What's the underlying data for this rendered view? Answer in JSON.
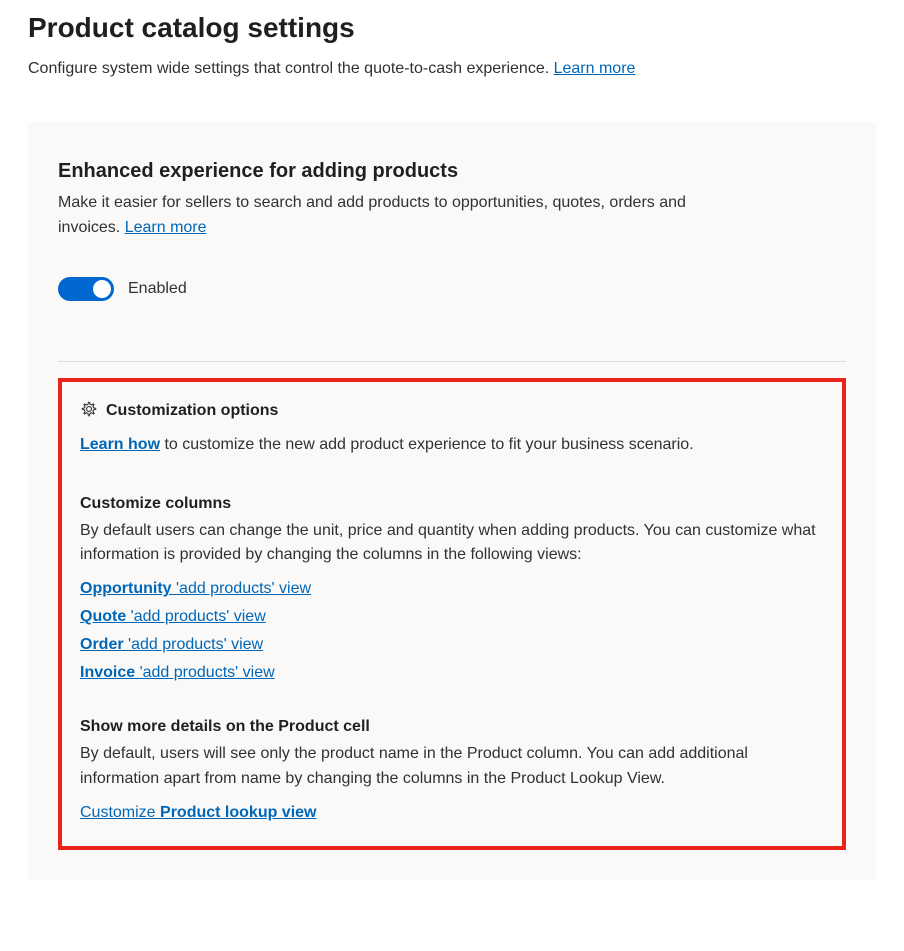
{
  "header": {
    "title": "Product catalog settings",
    "subtitle_prefix": "Configure system wide settings that control the quote-to-cash experience. ",
    "learn_more": "Learn more"
  },
  "enhanced": {
    "title": "Enhanced experience for adding products",
    "desc_prefix": "Make it easier for sellers to search and add products to opportunities, quotes, orders and invoices. ",
    "learn_more": "Learn more",
    "toggle_label": "Enabled"
  },
  "customization": {
    "header": "Customization options",
    "desc_link": "Learn how",
    "desc_rest": " to customize the new add product experience to fit your business scenario.",
    "columns": {
      "heading": "Customize columns",
      "desc": "By default users can change the unit, price and quantity when adding products. You can customize what information is provided by changing the columns in the following views:",
      "links": [
        {
          "bold": "Opportunity ",
          "rest": "'add products' view"
        },
        {
          "bold": "Quote ",
          "rest": "'add products' view"
        },
        {
          "bold": "Order ",
          "rest": "'add products' view"
        },
        {
          "bold": "Invoice ",
          "rest": "'add products' view"
        }
      ]
    },
    "product_cell": {
      "heading": "Show more details on the Product cell",
      "desc": "By default, users will see only the product name in the Product column. You can add additional information apart from name by changing the columns in the Product Lookup View.",
      "link_prefix": "Customize ",
      "link_bold": "Product lookup view"
    }
  }
}
